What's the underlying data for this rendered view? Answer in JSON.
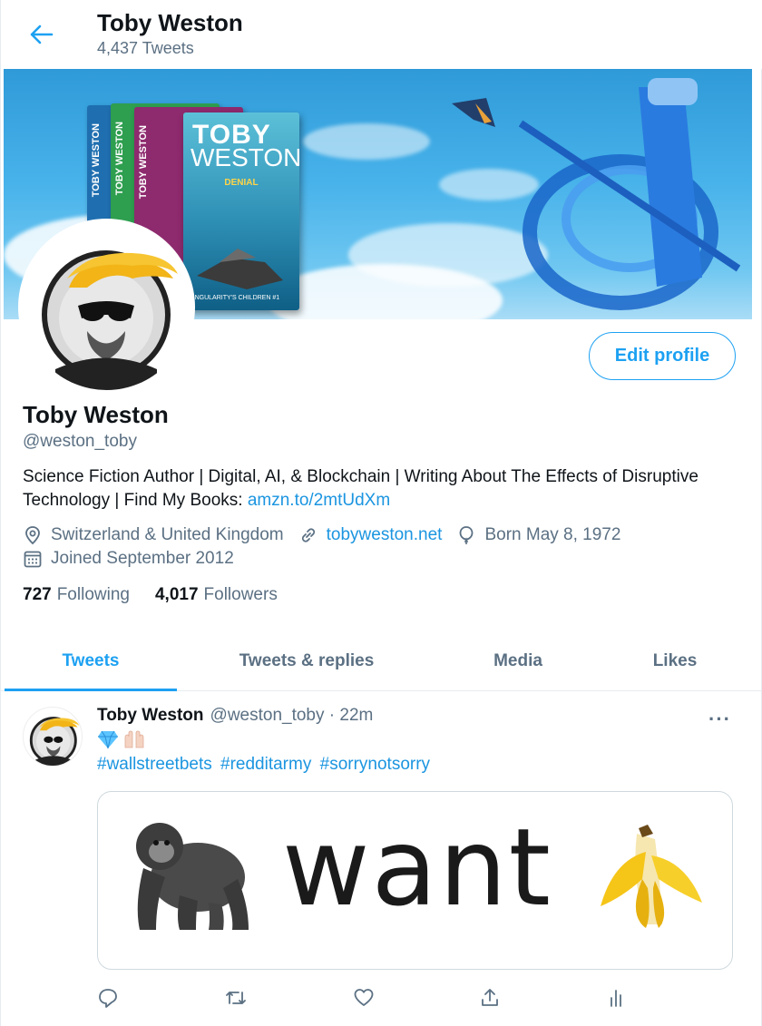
{
  "header": {
    "title": "Toby Weston",
    "tweet_count": "4,437 Tweets"
  },
  "banner": {
    "book_title_1": "TOBY",
    "book_title_2": "WESTON",
    "book_subtitle": "DENIAL",
    "book_series": "SINGULARITY'S CHILDREN #1",
    "spines": [
      "TOBY WESTON",
      "TOBY WESTON",
      "TOBY WESTON"
    ]
  },
  "profile": {
    "edit_label": "Edit profile",
    "name": "Toby Weston",
    "handle": "@weston_toby",
    "bio_text": "Science Fiction Author | Digital, AI, & Blockchain | Writing About The Effects of Disruptive Technology | Find My Books: ",
    "bio_link": "amzn.to/2mtUdXm",
    "location": "Switzerland & United Kingdom",
    "website": "tobyweston.net",
    "birthday": "Born May 8, 1972",
    "joined": "Joined September 2012",
    "following_count": "727",
    "following_label": "Following",
    "followers_count": "4,017",
    "followers_label": "Followers"
  },
  "tabs": [
    {
      "label": "Tweets",
      "active": true
    },
    {
      "label": "Tweets & replies",
      "active": false
    },
    {
      "label": "Media",
      "active": false
    },
    {
      "label": "Likes",
      "active": false
    }
  ],
  "tweet": {
    "name": "Toby Weston",
    "handle_time": "@weston_toby · 22m",
    "more": "···",
    "hashtags": [
      "#wallstreetbets",
      "#redditarmy",
      "#sorrynotsorry"
    ],
    "image_word": "want"
  },
  "icons": {
    "back": "back-arrow-icon",
    "location": "location-pin-icon",
    "link": "link-icon",
    "birthday": "balloon-icon",
    "joined": "calendar-icon",
    "reply": "reply-icon",
    "retweet": "retweet-icon",
    "like": "heart-icon",
    "share": "share-icon",
    "analytics": "analytics-icon"
  },
  "colors": {
    "accent": "#1da1f2",
    "link": "#1b95e0",
    "secondary_text": "#5b7083",
    "border": "#e6ecf0"
  }
}
